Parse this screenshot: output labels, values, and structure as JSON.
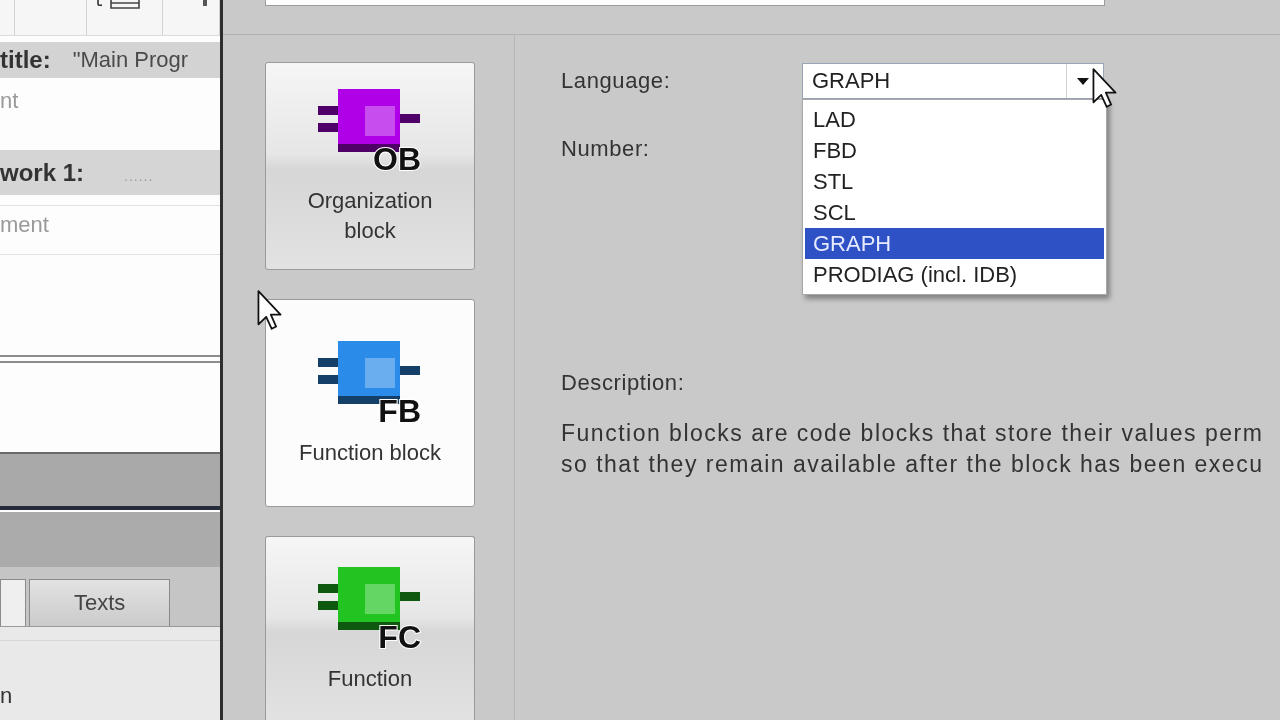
{
  "editor": {
    "block_title": {
      "label": "title:",
      "value": "\"Main Progr"
    },
    "block_comment": "nt",
    "network": {
      "label": "work 1:",
      "placeholder": "......"
    },
    "network_comment": "ment",
    "tabs": [
      {
        "selected": true
      },
      {
        "label": "Texts",
        "selected": false
      }
    ],
    "bottom_text": "n"
  },
  "dialog": {
    "block_types": [
      {
        "code": "OB",
        "label": "Organization block",
        "color": "#b000e8",
        "selected": false
      },
      {
        "code": "FB",
        "label": "Function block",
        "color": "#2a8ce8",
        "selected": true
      },
      {
        "code": "FC",
        "label": "Function",
        "color": "#22c422",
        "selected": false
      }
    ],
    "language": {
      "label": "Language:",
      "value": "GRAPH",
      "expanded": true,
      "options": [
        {
          "label": "LAD",
          "selected": false
        },
        {
          "label": "FBD",
          "selected": false
        },
        {
          "label": "STL",
          "selected": false
        },
        {
          "label": "SCL",
          "selected": false
        },
        {
          "label": "GRAPH",
          "selected": true
        },
        {
          "label": "PRODIAG (incl. IDB)",
          "selected": false
        }
      ]
    },
    "number": {
      "label": "Number:"
    },
    "description": {
      "label": "Description:",
      "lines": [
        "Function blocks are code blocks that store their values perm",
        "so that they remain available after the block has been execu"
      ]
    }
  }
}
